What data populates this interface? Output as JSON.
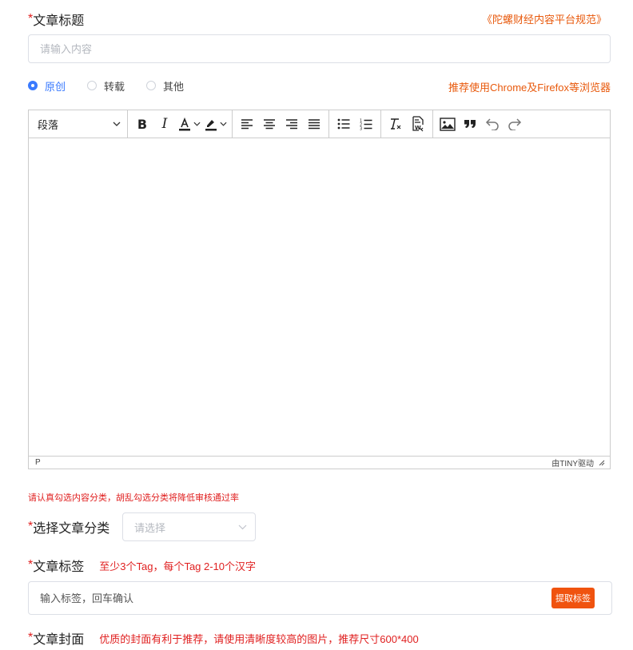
{
  "title_field": {
    "required_mark": "*",
    "label": "文章标题",
    "spec_link": "《陀螺财经内容平台规范》",
    "placeholder": "请输入内容"
  },
  "article_type": {
    "options": [
      {
        "label": "原创",
        "checked": true
      },
      {
        "label": "转载",
        "checked": false
      },
      {
        "label": "其他",
        "checked": false
      }
    ],
    "browser_tip": "推荐使用Chrome及Firefox等浏览器"
  },
  "editor": {
    "format_select": "段落",
    "toolbar_icons": [
      "bold-icon",
      "italic-icon",
      "text-color-icon",
      "highlight-icon",
      "align-left-icon",
      "align-center-icon",
      "align-right-icon",
      "align-justify-icon",
      "bullet-list-icon",
      "numbered-list-icon",
      "clear-format-icon",
      "paste-word-icon",
      "image-icon",
      "blockquote-icon",
      "undo-icon",
      "redo-icon"
    ],
    "status_path": "P",
    "powered_by": "由TINY驱动"
  },
  "category": {
    "warning": "请认真勾选内容分类，胡乱勾选分类将降低审核通过率",
    "required_mark": "*",
    "label": "选择文章分类",
    "placeholder": "请选择"
  },
  "tags": {
    "required_mark": "*",
    "label": "文章标签",
    "hint": "至少3个Tag，每个Tag 2-10个汉字",
    "placeholder": "输入标签，回车确认",
    "extract_button": "提取标签"
  },
  "cover": {
    "required_mark": "*",
    "label": "文章封面",
    "hint": "优质的封面有利于推荐，请使用清晰度较高的图片，推荐尺寸600*400"
  },
  "colors": {
    "accent_orange": "#e8590c",
    "required_red": "#e02020",
    "radio_blue": "#3a7afe",
    "button_orange": "#f0530f"
  }
}
